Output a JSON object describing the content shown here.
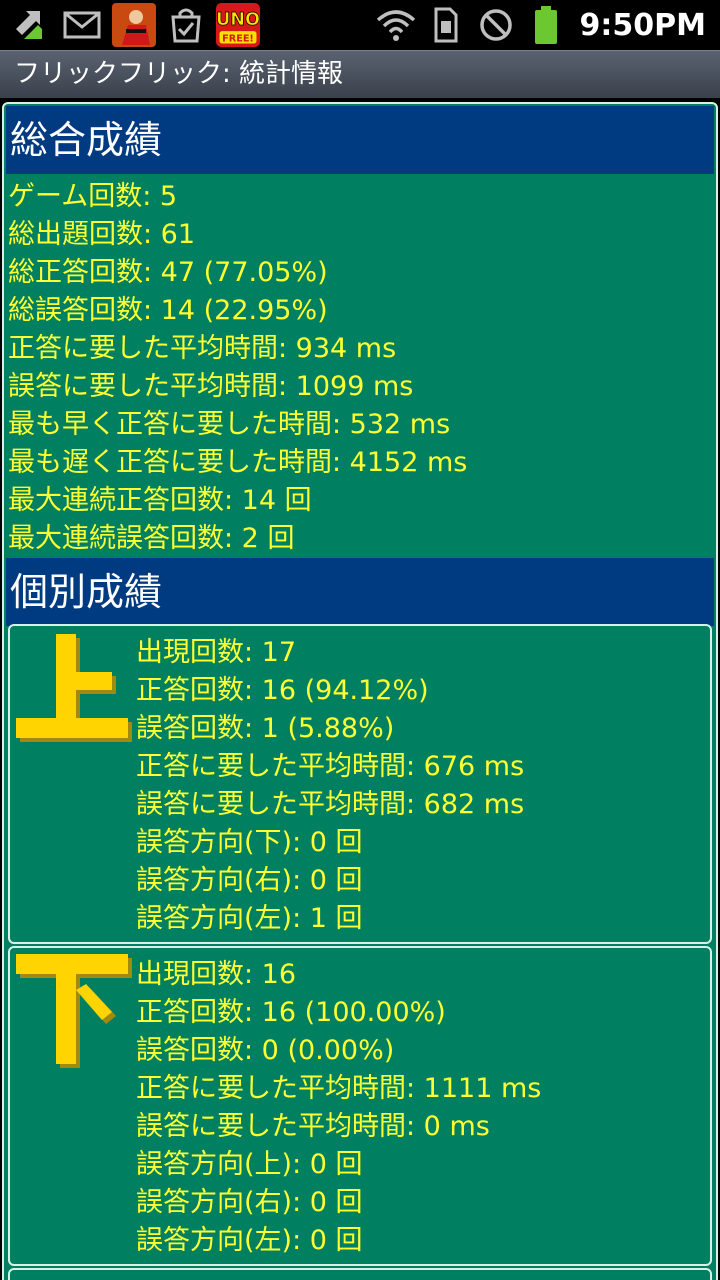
{
  "status_bar": {
    "time": "9:50PM",
    "notification_icons": [
      "sync-icon",
      "gmail-icon",
      "app-icon",
      "market-update-icon",
      "uno-icon"
    ],
    "system_icons": [
      "wifi-icon",
      "sim-icon",
      "no-sign-icon",
      "battery-icon"
    ]
  },
  "title": "フリックフリック: 統計情報",
  "overall": {
    "header": "総合成績",
    "lines": [
      "ゲーム回数: 5",
      "総出題回数: 61",
      "総正答回数: 47 (77.05%)",
      "総誤答回数: 14 (22.95%)",
      "正答に要した平均時間: 934 ms",
      "誤答に要した平均時間: 1099 ms",
      "最も早く正答に要した時間: 532 ms",
      "最も遅く正答に要した時間: 4152 ms",
      "最大連続正答回数: 14 回",
      "最大連続誤答回数: 2 回"
    ]
  },
  "individual": {
    "header": "個別成績",
    "items": [
      {
        "glyph": "上",
        "lines": [
          "出現回数: 17",
          "正答回数: 16 (94.12%)",
          "誤答回数: 1 (5.88%)",
          "正答に要した平均時間: 676 ms",
          "誤答に要した平均時間: 682 ms",
          "誤答方向(下): 0 回",
          "誤答方向(右): 0 回",
          "誤答方向(左): 1 回"
        ]
      },
      {
        "glyph": "下",
        "lines": [
          "出現回数: 16",
          "正答回数: 16 (100.00%)",
          "誤答回数: 0 (0.00%)",
          "正答に要した平均時間: 1111 ms",
          "誤答に要した平均時間: 0 ms",
          "誤答方向(上): 0 回",
          "誤答方向(右): 0 回",
          "誤答方向(左): 0 回"
        ]
      }
    ]
  },
  "colors": {
    "panel": "#008060",
    "header": "#003a80",
    "text": "#ffff33",
    "glyph": "#ffd400"
  }
}
